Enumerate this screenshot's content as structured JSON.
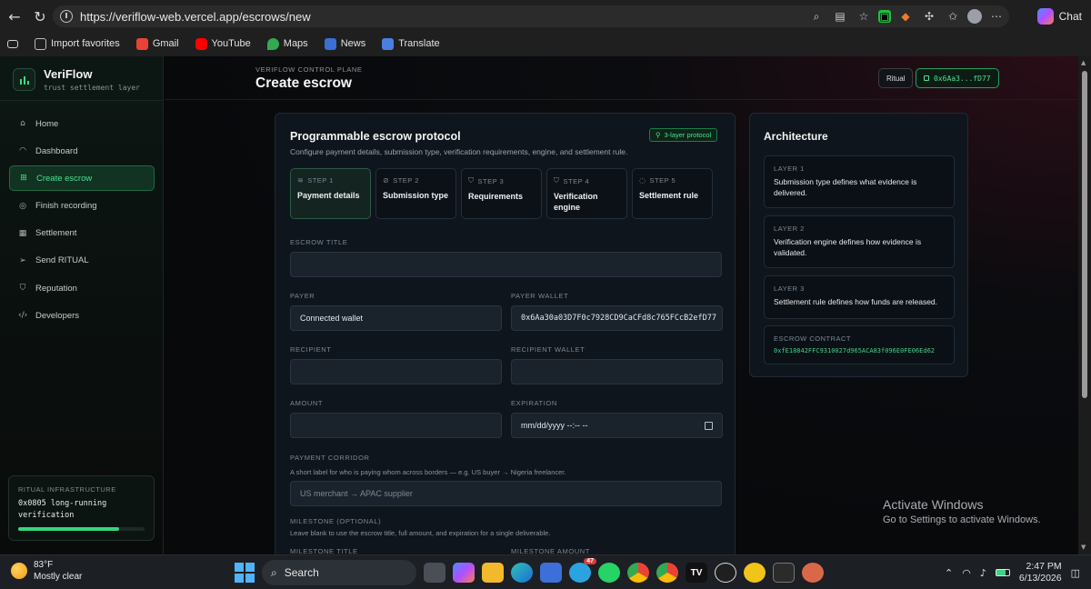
{
  "browser": {
    "url": "https://veriflow-web.vercel.app/escrows/new",
    "chat_label": "Chat",
    "favorites": [
      {
        "label": "Import favorites",
        "color": "#3a3a3a"
      },
      {
        "label": "Gmail",
        "color": "#ea4335"
      },
      {
        "label": "YouTube",
        "color": "#ff0000"
      },
      {
        "label": "Maps",
        "color": "#34a853"
      },
      {
        "label": "News",
        "color": "#3b6fd6"
      },
      {
        "label": "Translate",
        "color": "#4a7fe0"
      }
    ]
  },
  "sidebar": {
    "brand_name": "VeriFlow",
    "brand_tagline": "trust settlement layer",
    "items": [
      {
        "label": "Home",
        "icon": "home-icon"
      },
      {
        "label": "Dashboard",
        "icon": "gauge-icon"
      },
      {
        "label": "Create escrow",
        "icon": "plus-square-icon",
        "active": true
      },
      {
        "label": "Finish recording",
        "icon": "record-icon"
      },
      {
        "label": "Settlement",
        "icon": "grid-icon"
      },
      {
        "label": "Send RITUAL",
        "icon": "send-icon"
      },
      {
        "label": "Reputation",
        "icon": "shield-icon"
      },
      {
        "label": "Developers",
        "icon": "code-icon"
      }
    ],
    "infra": {
      "label": "RITUAL INFRASTRUCTURE",
      "text": "0x0805 long-running verification",
      "progress": 0.8
    }
  },
  "header": {
    "eyebrow": "VERIFLOW CONTROL PLANE",
    "title": "Create escrow",
    "network_label": "Ritual",
    "wallet_label": "0x6Aa3...fD77"
  },
  "form": {
    "title": "Programmable escrow protocol",
    "subtitle": "Configure payment details, submission type, verification requirements, engine, and settlement rule.",
    "badge": "3-layer protocol",
    "steps": [
      {
        "num": "STEP 1",
        "label": "Payment details",
        "icon": "layers-icon",
        "active": true
      },
      {
        "num": "STEP 2",
        "label": "Submission type",
        "icon": "link-icon"
      },
      {
        "num": "STEP 3",
        "label": "Requirements",
        "icon": "shield-icon"
      },
      {
        "num": "STEP 4",
        "label": "Verification engine",
        "icon": "shield-check-icon"
      },
      {
        "num": "STEP 5",
        "label": "Settlement rule",
        "icon": "check-circle-icon"
      }
    ],
    "escrow_title_label": "ESCROW TITLE",
    "escrow_title_value": "",
    "payer_label": "PAYER",
    "payer_value": "Connected wallet",
    "payer_wallet_label": "PAYER WALLET",
    "payer_wallet_value": "0x6Aa30a03D7F0c7928CD9CaCFd8c765FCcB2efD77",
    "recipient_label": "RECIPIENT",
    "recipient_value": "",
    "recipient_wallet_label": "RECIPIENT WALLET",
    "recipient_wallet_value": "",
    "amount_label": "AMOUNT",
    "amount_value": "",
    "expiration_label": "EXPIRATION",
    "expiration_placeholder": "mm/dd/yyyy --:-- --",
    "corridor_label": "PAYMENT CORRIDOR",
    "corridor_help": "A short label for who is paying whom across borders — e.g. US buyer → Nigeria freelancer.",
    "corridor_placeholder": "US merchant → APAC supplier",
    "milestone_label": "MILESTONE (OPTIONAL)",
    "milestone_help": "Leave blank to use the escrow title, full amount, and expiration for a single deliverable.",
    "milestone_title_label": "MILESTONE TITLE",
    "milestone_amount_label": "MILESTONE AMOUNT"
  },
  "architecture": {
    "title": "Architecture",
    "layers": [
      {
        "label": "LAYER 1",
        "text": "Submission type defines what evidence is delivered."
      },
      {
        "label": "LAYER 2",
        "text": "Verification engine defines how evidence is validated."
      },
      {
        "label": "LAYER 3",
        "text": "Settlement rule defines how funds are released."
      }
    ],
    "contract_label": "ESCROW CONTRACT",
    "contract_address": "0xfE18842FFC9310027d965ACA83f096E0FE06Ed62"
  },
  "watermark": {
    "line1": "Activate Windows",
    "line2": "Go to Settings to activate Windows."
  },
  "taskbar": {
    "temp": "83°F",
    "weather": "Mostly clear",
    "search": "Search",
    "time": "2:47 PM",
    "date": "6/13/2026",
    "telegram_badge": "47"
  }
}
